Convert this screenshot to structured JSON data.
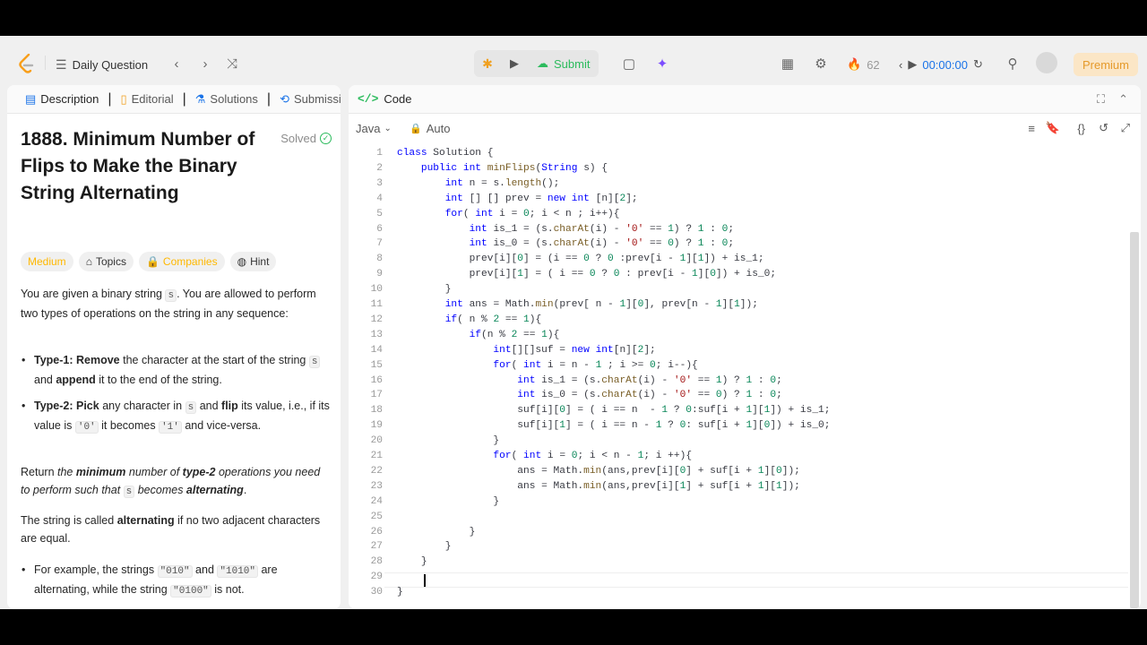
{
  "nav": {
    "daily": "Daily Question",
    "submit": "Submit",
    "streak": "62",
    "timer": "00:00:00",
    "premium": "Premium"
  },
  "left": {
    "tabs": [
      {
        "label": "Description"
      },
      {
        "label": "Editorial"
      },
      {
        "label": "Solutions"
      },
      {
        "label": "Submissi"
      }
    ],
    "title": "1888. Minimum Number of Flips to Make the Binary String Alternating",
    "solved": "Solved",
    "chips": {
      "medium": "Medium",
      "topics": "Topics",
      "companies": "Companies",
      "hint": "Hint"
    },
    "p1a": "You are given a binary string ",
    "p1code": "s",
    "p1b": ". You are allowed to perform two types of operations on the string in any sequence:",
    "b1_bold": "Type-1: Remove",
    "b1_a": " the character at the start of the string ",
    "b1_code": "s",
    "b1_and": " and ",
    "b1_bold2": "append",
    "b1_b": " it to the end of the string.",
    "b2_bold": "Type-2: Pick",
    "b2_a": " any character in ",
    "b2_code": "s",
    "b2_and": " and ",
    "b2_bold2": "flip",
    "b2_b": " its value, i.e., if its value is ",
    "b2_c0": "'0'",
    "b2_c": " it becomes ",
    "b2_c1": "'1'",
    "b2_d": " and vice-versa.",
    "p2a": "Return ",
    "p2em": "the ",
    "p2bold": "minimum",
    "p2em2": " number of ",
    "p2bold2": "type-2",
    "p2em3": " operations you need to perform such that ",
    "p2code": "s",
    "p2em4": " becomes ",
    "p2bold3": "alternating",
    "p2end": ".",
    "p3a": "The string is called ",
    "p3bold": "alternating",
    "p3b": " if no two adjacent characters are equal.",
    "b3a": "For example, the strings ",
    "b3c1": "\"010\"",
    "b3and": " and ",
    "b3c2": "\"1010\"",
    "b3b": " are alternating, while the string ",
    "b3c3": "\"0100\"",
    "b3c": " is not."
  },
  "code_panel": {
    "title": "Code",
    "language": "Java",
    "mode": "Auto",
    "lines": [
      "class Solution {",
      "    public int minFlips(String s) {",
      "        int n = s.length();",
      "        int [] [] prev = new int [n][2];",
      "        for( int i = 0; i < n ; i++){",
      "            int is_1 = (s.charAt(i) - '0' == 1) ? 1 : 0;",
      "            int is_0 = (s.charAt(i) - '0' == 0) ? 1 : 0;",
      "            prev[i][0] = (i == 0 ? 0 :prev[i - 1][1]) + is_1;",
      "            prev[i][1] = ( i == 0 ? 0 : prev[i - 1][0]) + is_0;",
      "        }",
      "        int ans = Math.min(prev[ n - 1][0], prev[n - 1][1]);",
      "        if( n % 2 == 1){",
      "            if(n % 2 == 1){",
      "                int[][]suf = new int[n][2];",
      "                for( int i = n - 1 ; i >= 0; i--){",
      "                    int is_1 = (s.charAt(i) - '0' == 1) ? 1 : 0;",
      "                    int is_0 = (s.charAt(i) - '0' == 0) ? 1 : 0;",
      "                    suf[i][0] = ( i == n  - 1 ? 0:suf[i + 1][1]) + is_1;",
      "                    suf[i][1] = ( i == n - 1 ? 0: suf[i + 1][0]) + is_0;",
      "                }",
      "                for( int i = 0; i < n - 1; i ++){",
      "                    ans = Math.min(ans,prev[i][0] + suf[i + 1][0]);",
      "                    ans = Math.min(ans,prev[i][1] + suf[i + 1][1]);",
      "                }",
      "",
      "            }",
      "        }",
      "    }",
      "    ",
      "}"
    ]
  }
}
